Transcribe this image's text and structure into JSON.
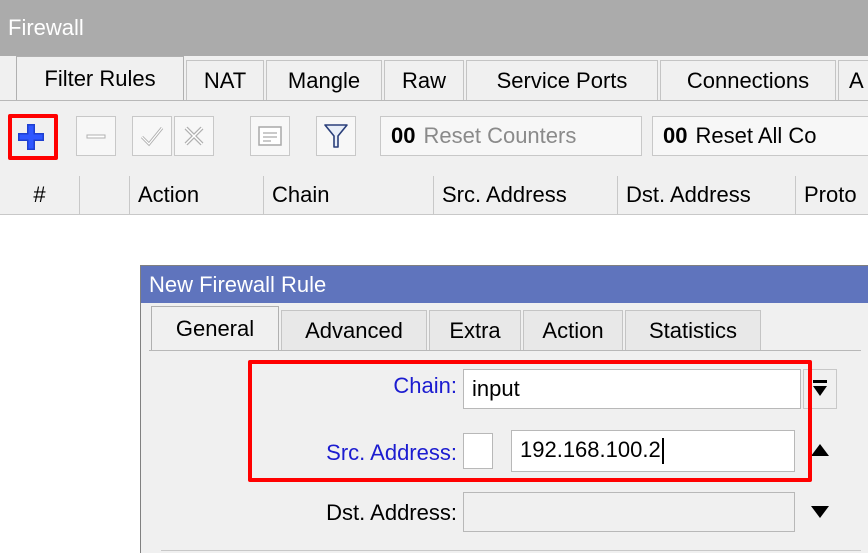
{
  "window": {
    "title": "Firewall"
  },
  "tabs": [
    {
      "label": "Filter Rules",
      "active": true
    },
    {
      "label": "NAT",
      "active": false
    },
    {
      "label": "Mangle",
      "active": false
    },
    {
      "label": "Raw",
      "active": false
    },
    {
      "label": "Service Ports",
      "active": false
    },
    {
      "label": "Connections",
      "active": false
    },
    {
      "label": "A",
      "active": false
    }
  ],
  "toolbar": {
    "add": {
      "icon": "plus-icon",
      "highlighted": true
    },
    "remove": {
      "icon": "minus-icon"
    },
    "enable": {
      "icon": "check-icon"
    },
    "disable": {
      "icon": "x-icon"
    },
    "comment": {
      "icon": "comment-icon"
    },
    "filter": {
      "icon": "filter-icon"
    },
    "reset_counters": {
      "prefix": "00",
      "label": "Reset Counters",
      "enabled": false
    },
    "reset_all": {
      "prefix": "00",
      "label": "Reset All Co",
      "enabled": true
    }
  },
  "table": {
    "columns": [
      "#",
      "",
      "Action",
      "Chain",
      "Src. Address",
      "Dst. Address",
      "Proto"
    ],
    "rows": []
  },
  "dialog": {
    "title": "New Firewall Rule",
    "tabs": [
      {
        "label": "General",
        "active": true
      },
      {
        "label": "Advanced",
        "active": false
      },
      {
        "label": "Extra",
        "active": false
      },
      {
        "label": "Action",
        "active": false
      },
      {
        "label": "Statistics",
        "active": false
      }
    ],
    "fields": {
      "chain": {
        "label": "Chain:",
        "value": "input"
      },
      "src_address": {
        "label": "Src. Address:",
        "value": "192.168.100.2",
        "negate": false
      },
      "dst_address": {
        "label": "Dst. Address:",
        "value": ""
      }
    }
  },
  "colors": {
    "title_bar": "#ababab",
    "dialog_title_bar": "#5f74bd",
    "field_label_blue": "#1c1cd0",
    "highlight": "#ff0000",
    "add_icon": "#1e3fd0"
  }
}
